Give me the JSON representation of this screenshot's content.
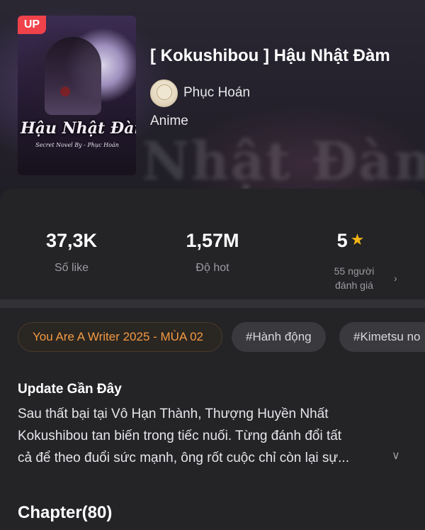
{
  "book": {
    "title": "[ Kokushibou ] Hậu Nhật Đàm",
    "author": "Phục Hoán",
    "genre": "Anime",
    "badge": "UP",
    "cover_title": "Hậu Nhật Đàm",
    "cover_subtitle": "Secret Novel By - Phục Hoán"
  },
  "stats": {
    "likes_value": "37,3K",
    "likes_label": "Số like",
    "hot_value": "1,57M",
    "hot_label": "Độ hot",
    "rating_value": "5",
    "rating_line1": "55 người",
    "rating_line2": "đánh giá"
  },
  "tags": [
    "You Are A Writer 2025 - MÙA 02",
    "#Hành động",
    "#Kimetsu no"
  ],
  "update": {
    "heading": "Update Gần Đây",
    "line1": "Sau thất bại tại Vô Hạn Thành, Thượng Huyền Nhất",
    "line2": "Kokushibou tan biến trong tiếc nuối. Từng đánh đổi tất",
    "line3": "cả để theo đuổi sức mạnh, ông rốt cuộc chỉ còn lại sự..."
  },
  "chapters": {
    "heading": "Chapter(80)"
  },
  "colors": {
    "accent_orange": "#f39a43",
    "badge_red": "#f0424a",
    "star": "#f3b515"
  },
  "icons": [
    "star-icon",
    "chevron-right-icon",
    "chevron-down-icon"
  ]
}
